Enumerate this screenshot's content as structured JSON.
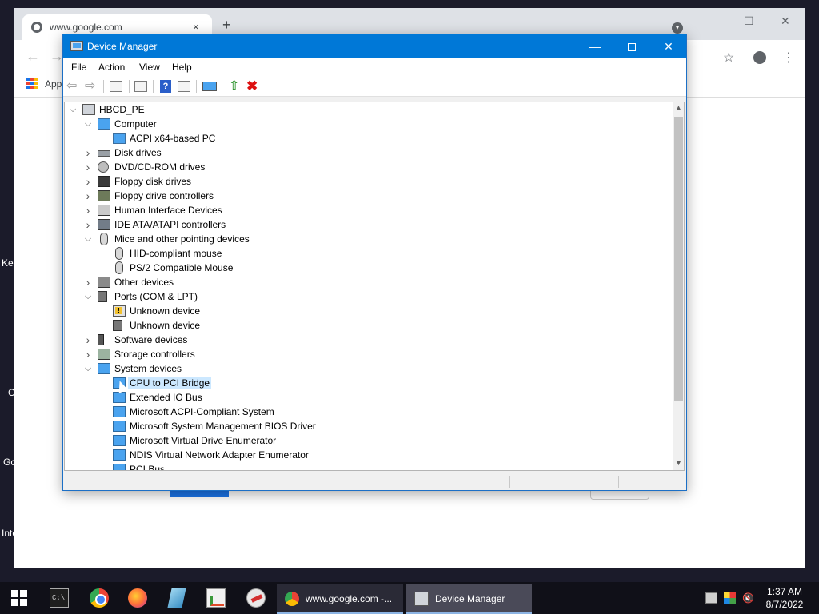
{
  "desktop": {
    "fragments": [
      "Ke",
      "C",
      "Go",
      "Inte"
    ]
  },
  "chrome": {
    "tab_title": "www.google.com",
    "tab_close": "×",
    "new_tab": "+",
    "apps_label": "Apps",
    "nav_back": "←",
    "nav_forward": "→",
    "minimize": "—",
    "maximize": "☐",
    "close": "✕",
    "star": "☆",
    "menu": "⋮"
  },
  "device_manager": {
    "title": "Device Manager",
    "window_controls": {
      "minimize": "—",
      "close": "✕"
    },
    "menu": [
      "File",
      "Action",
      "View",
      "Help"
    ],
    "toolbar": {
      "back": "⇦",
      "forward": "⇨",
      "help": "?",
      "update": "⇧",
      "uninstall": "✖"
    },
    "tree": [
      {
        "label": "HBCD_PE",
        "level": 0,
        "expander": "expanded",
        "icon": "computer-icon"
      },
      {
        "label": "Computer",
        "level": 1,
        "expander": "expanded",
        "icon": "monitor-icon"
      },
      {
        "label": "ACPI x64-based PC",
        "level": 2,
        "expander": "none",
        "icon": "monitor-icon"
      },
      {
        "label": "Disk drives",
        "level": 1,
        "expander": "collapsed",
        "icon": "disk-drive-icon"
      },
      {
        "label": "DVD/CD-ROM drives",
        "level": 1,
        "expander": "collapsed",
        "icon": "dvd-icon"
      },
      {
        "label": "Floppy disk drives",
        "level": 1,
        "expander": "collapsed",
        "icon": "floppy-icon"
      },
      {
        "label": "Floppy drive controllers",
        "level": 1,
        "expander": "collapsed",
        "icon": "controller-icon"
      },
      {
        "label": "Human Interface Devices",
        "level": 1,
        "expander": "collapsed",
        "icon": "hid-icon"
      },
      {
        "label": "IDE ATA/ATAPI controllers",
        "level": 1,
        "expander": "collapsed",
        "icon": "ide-icon"
      },
      {
        "label": "Mice and other pointing devices",
        "level": 1,
        "expander": "expanded",
        "icon": "mouse-icon"
      },
      {
        "label": "HID-compliant mouse",
        "level": 2,
        "expander": "none",
        "icon": "mouse-icon"
      },
      {
        "label": "PS/2 Compatible Mouse",
        "level": 2,
        "expander": "none",
        "icon": "mouse-icon"
      },
      {
        "label": "Other devices",
        "level": 1,
        "expander": "collapsed",
        "icon": "other-devices-icon"
      },
      {
        "label": "Ports (COM & LPT)",
        "level": 1,
        "expander": "expanded",
        "icon": "port-icon"
      },
      {
        "label": "Unknown device",
        "level": 2,
        "expander": "none",
        "icon": "warning-device-icon"
      },
      {
        "label": "Unknown device",
        "level": 2,
        "expander": "none",
        "icon": "port-icon"
      },
      {
        "label": "Software devices",
        "level": 1,
        "expander": "collapsed",
        "icon": "software-device-icon"
      },
      {
        "label": "Storage controllers",
        "level": 1,
        "expander": "collapsed",
        "icon": "storage-icon"
      },
      {
        "label": "System devices",
        "level": 1,
        "expander": "expanded",
        "icon": "system-device-icon"
      },
      {
        "label": "CPU to PCI Bridge",
        "level": 2,
        "expander": "none",
        "icon": "system-device-icon",
        "selected": true
      },
      {
        "label": "Extended IO Bus",
        "level": 2,
        "expander": "none",
        "icon": "system-device-icon"
      },
      {
        "label": "Microsoft ACPI-Compliant System",
        "level": 2,
        "expander": "none",
        "icon": "system-device-icon"
      },
      {
        "label": "Microsoft System Management BIOS Driver",
        "level": 2,
        "expander": "none",
        "icon": "system-device-icon"
      },
      {
        "label": "Microsoft Virtual Drive Enumerator",
        "level": 2,
        "expander": "none",
        "icon": "system-device-icon"
      },
      {
        "label": "NDIS Virtual Network Adapter Enumerator",
        "level": 2,
        "expander": "none",
        "icon": "system-device-icon"
      },
      {
        "label": "PCI Bus",
        "level": 2,
        "expander": "none",
        "icon": "system-device-icon"
      }
    ],
    "scroll": {
      "up": "▲",
      "down": "▼"
    }
  },
  "taskbar": {
    "buttons": [
      {
        "label": "www.google.com -...",
        "icon": "chrome-icon"
      },
      {
        "label": "Device Manager",
        "icon": "device-manager-icon"
      }
    ],
    "cmd_glyph": "C:\\",
    "tray_volume": "🔇",
    "clock": {
      "time": "1:37 AM",
      "date": "8/7/2022"
    }
  },
  "colors": {
    "titlebar": "#0078d7",
    "selection": "#cce8ff",
    "taskbar": "#101018"
  }
}
